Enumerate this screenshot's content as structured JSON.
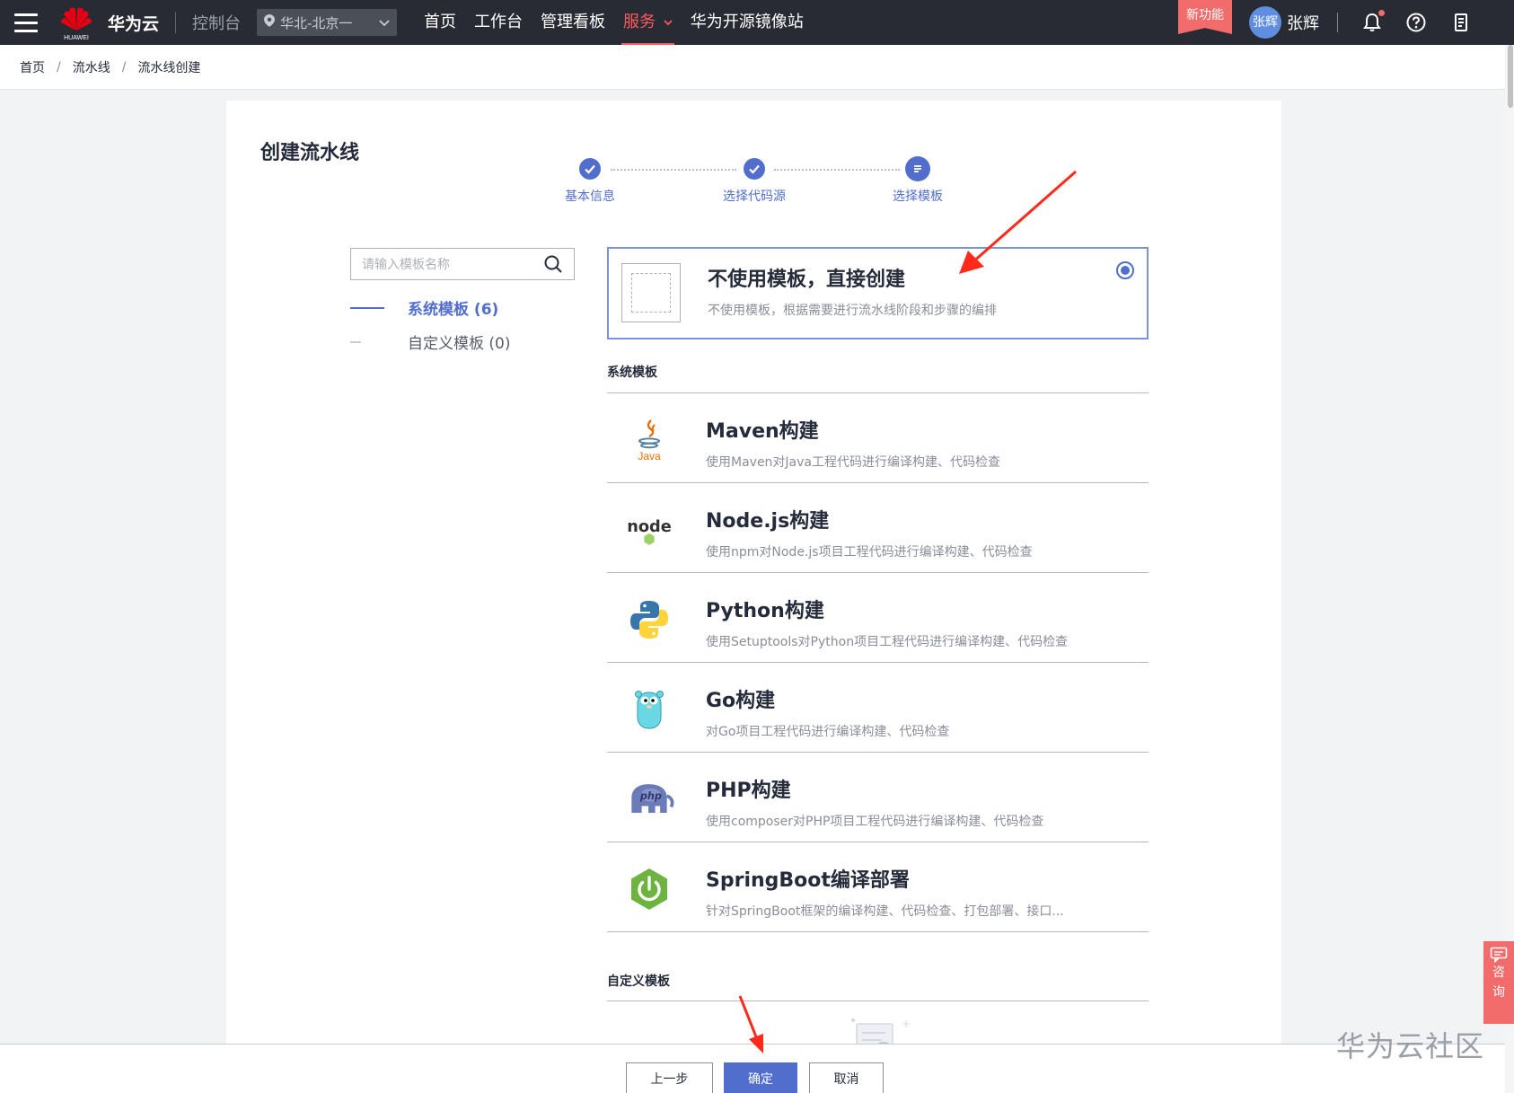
{
  "topbar": {
    "logo_text": "HUAWEI",
    "brand": "华为云",
    "console": "控制台",
    "region": "华北-北京一",
    "nav": [
      {
        "label": "首页"
      },
      {
        "label": "工作台"
      },
      {
        "label": "管理看板"
      },
      {
        "label": "服务",
        "active": true
      },
      {
        "label": "华为开源镜像站"
      }
    ],
    "new_badge": "新功能",
    "avatar_text": "张辉",
    "username": "张辉",
    "icons": [
      "bell-icon",
      "help-icon",
      "clipboard-icon"
    ],
    "accent_color": "#ff5a5f"
  },
  "breadcrumb": [
    "首页",
    "流水线",
    "流水线创建"
  ],
  "page_title": "创建流水线",
  "steps": [
    {
      "label": "基本信息",
      "state": "done"
    },
    {
      "label": "选择代码源",
      "state": "done"
    },
    {
      "label": "选择模板",
      "state": "current"
    }
  ],
  "search": {
    "placeholder": "请输入模板名称"
  },
  "categories": [
    {
      "label": "系统模板 (6)",
      "active": true
    },
    {
      "label": "自定义模板 (0)",
      "active": false
    }
  ],
  "blank_template": {
    "title": "不使用模板，直接创建",
    "desc": "不使用模板，根据需要进行流水线阶段和步骤的编排",
    "selected": true
  },
  "system_section": "系统模板",
  "templates": [
    {
      "title": "Maven构建",
      "desc": "使用Maven对Java工程代码进行编译构建、代码检查",
      "icon": "java-icon",
      "icon_text": "Java"
    },
    {
      "title": "Node.js构建",
      "desc": "使用npm对Node.js项目工程代码进行编译构建、代码检查",
      "icon": "nodejs-icon",
      "icon_text": "node"
    },
    {
      "title": "Python构建",
      "desc": "使用Setuptools对Python项目工程代码进行编译构建、代码检查",
      "icon": "python-icon"
    },
    {
      "title": "Go构建",
      "desc": "对Go项目工程代码进行编译构建、代码检查",
      "icon": "go-gopher-icon"
    },
    {
      "title": "PHP构建",
      "desc": "使用composer对PHP项目工程代码进行编译构建、代码检查",
      "icon": "php-elephant-icon",
      "icon_text": "php"
    },
    {
      "title": "SpringBoot编译部署",
      "desc": "针对SpringBoot框架的编译构建、代码检查、打包部署、接口...",
      "icon": "springboot-power-icon"
    }
  ],
  "custom_section": "自定义模板",
  "footer": {
    "prev": "上一步",
    "confirm": "确定",
    "cancel": "取消"
  },
  "consult": {
    "chars": [
      "咨",
      "询"
    ]
  },
  "watermark": "华为云社区",
  "colors": {
    "primary": "#526ecc",
    "topbar": "#282b33",
    "badge": "#f36c6c",
    "annotation_arrow": "#ff2a1a"
  }
}
